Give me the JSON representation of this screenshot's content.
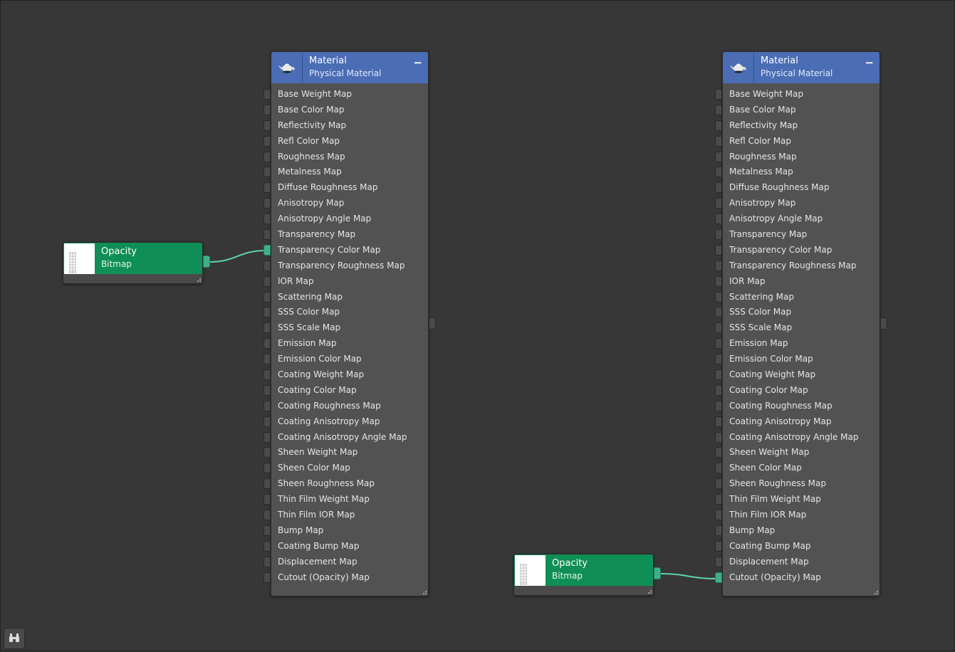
{
  "material_nodes": [
    {
      "title": "Material",
      "subtitle": "Physical Material",
      "collapse_label": "−",
      "slots": [
        "Base Weight Map",
        "Base Color Map",
        "Reflectivity Map",
        "Refl Color Map",
        "Roughness Map",
        "Metalness Map",
        "Diffuse Roughness Map",
        "Anisotropy Map",
        "Anisotropy Angle Map",
        "Transparency Map",
        "Transparency Color Map",
        "Transparency Roughness Map",
        "IOR Map",
        "Scattering Map",
        "SSS Color Map",
        "SSS Scale Map",
        "Emission Map",
        "Emission Color Map",
        "Coating Weight Map",
        "Coating Color Map",
        "Coating Roughness Map",
        "Coating Anisotropy Map",
        "Coating Anisotropy Angle Map",
        "Sheen Weight Map",
        "Sheen Color Map",
        "Sheen Roughness Map",
        "Thin Film Weight Map",
        "Thin Film IOR Map",
        "Bump Map",
        "Coating Bump Map",
        "Displacement Map",
        "Cutout (Opacity) Map"
      ],
      "connected_slot": "Transparency Color Map"
    },
    {
      "title": "Material",
      "subtitle": "Physical Material",
      "collapse_label": "−",
      "slots": [
        "Base Weight Map",
        "Base Color Map",
        "Reflectivity Map",
        "Refl Color Map",
        "Roughness Map",
        "Metalness Map",
        "Diffuse Roughness Map",
        "Anisotropy Map",
        "Anisotropy Angle Map",
        "Transparency Map",
        "Transparency Color Map",
        "Transparency Roughness Map",
        "IOR Map",
        "Scattering Map",
        "SSS Color Map",
        "SSS Scale Map",
        "Emission Map",
        "Emission Color Map",
        "Coating Weight Map",
        "Coating Color Map",
        "Coating Roughness Map",
        "Coating Anisotropy Map",
        "Coating Anisotropy Angle Map",
        "Sheen Weight Map",
        "Sheen Color Map",
        "Sheen Roughness Map",
        "Thin Film Weight Map",
        "Thin Film IOR Map",
        "Bump Map",
        "Coating Bump Map",
        "Displacement Map",
        "Cutout (Opacity) Map"
      ],
      "connected_slot": "Cutout (Opacity) Map"
    }
  ],
  "bitmap_nodes": [
    {
      "title": "Opacity",
      "subtitle": "Bitmap"
    },
    {
      "title": "Opacity",
      "subtitle": "Bitmap"
    }
  ],
  "colors": {
    "material_header": "#4a6db5",
    "bitmap_header": "#0f8f55",
    "wire": "#5fd3a6",
    "canvas": "#373737"
  },
  "icons": {
    "material_icon": "teapot-icon",
    "navigator": "binoculars-icon"
  }
}
